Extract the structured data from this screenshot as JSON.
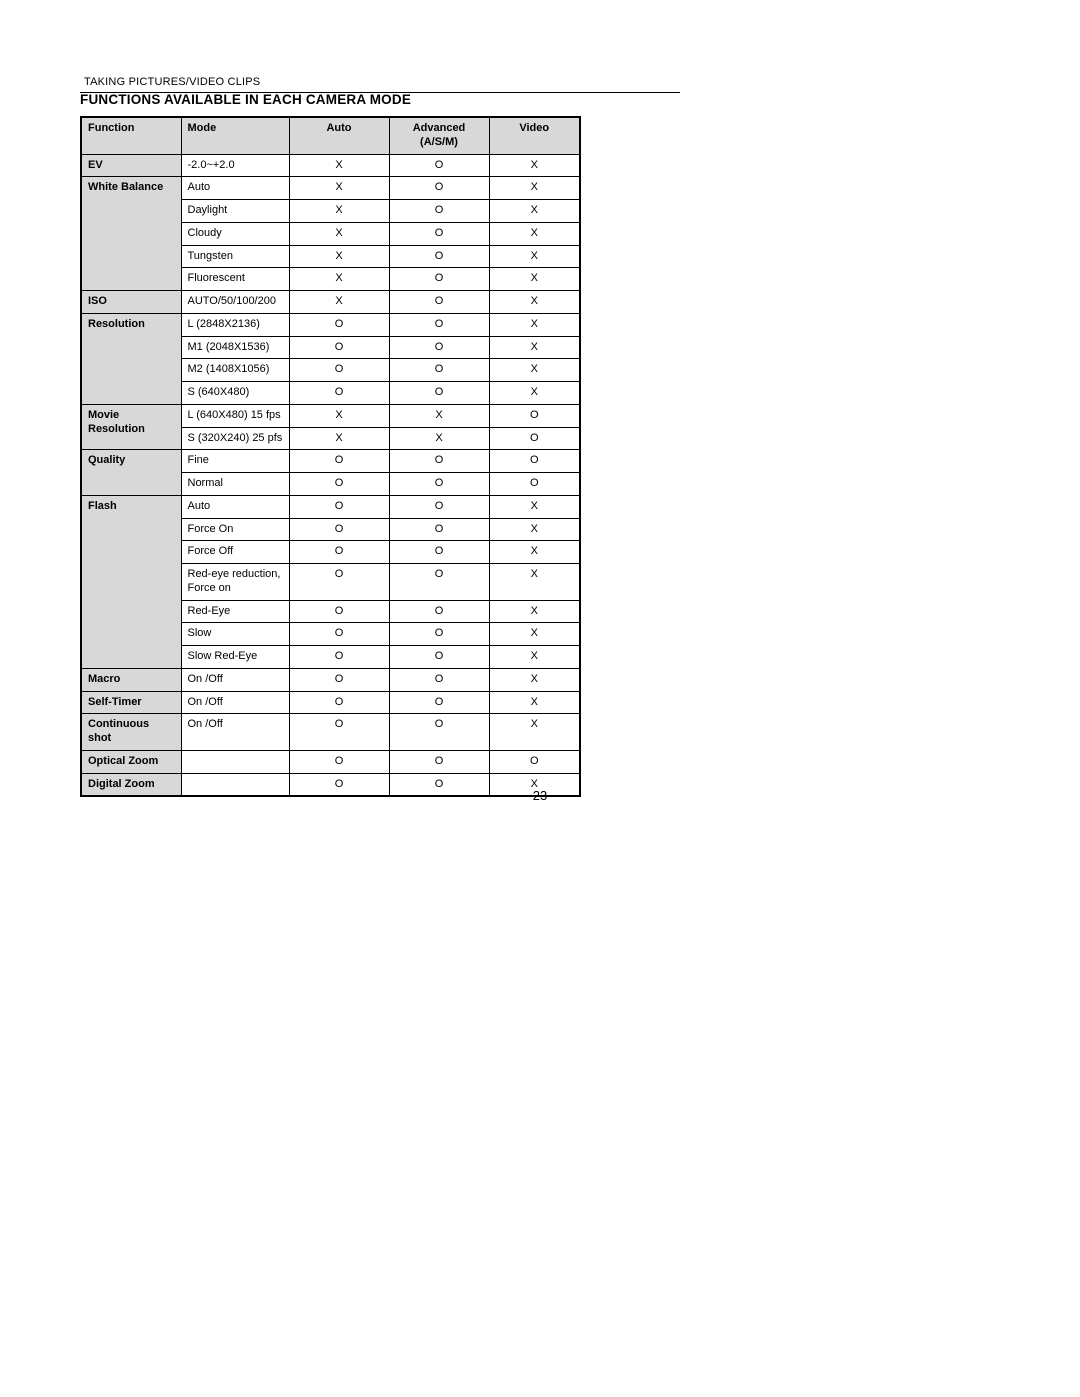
{
  "breadcrumb": "TAKING PICTURES/VIDEO CLIPS",
  "title": "FUNCTIONS AVAILABLE IN EACH CAMERA MODE",
  "page_number": "23",
  "headers": {
    "function": "Function",
    "mode": "Mode",
    "auto": "Auto",
    "advanced": "Advanced (A/S/M)",
    "video": "Video"
  },
  "rows": [
    {
      "function": "EV",
      "span": 1,
      "modes": [
        {
          "mode": "-2.0~+2.0",
          "auto": "X",
          "advanced": "O",
          "video": "X"
        }
      ]
    },
    {
      "function": "White Balance",
      "span": 5,
      "modes": [
        {
          "mode": "Auto",
          "auto": "X",
          "advanced": "O",
          "video": "X"
        },
        {
          "mode": "Daylight",
          "auto": "X",
          "advanced": "O",
          "video": "X"
        },
        {
          "mode": "Cloudy",
          "auto": "X",
          "advanced": "O",
          "video": "X"
        },
        {
          "mode": "Tungsten",
          "auto": "X",
          "advanced": "O",
          "video": "X"
        },
        {
          "mode": "Fluorescent",
          "auto": "X",
          "advanced": "O",
          "video": "X"
        }
      ]
    },
    {
      "function": "ISO",
      "span": 1,
      "modes": [
        {
          "mode": "AUTO/50/100/200",
          "auto": "X",
          "advanced": "O",
          "video": "X"
        }
      ]
    },
    {
      "function": "Resolution",
      "span": 4,
      "modes": [
        {
          "mode": "L (2848X2136)",
          "auto": "O",
          "advanced": "O",
          "video": "X"
        },
        {
          "mode": "M1 (2048X1536)",
          "auto": "O",
          "advanced": "O",
          "video": "X"
        },
        {
          "mode": "M2 (1408X1056)",
          "auto": "O",
          "advanced": "O",
          "video": "X"
        },
        {
          "mode": "S (640X480)",
          "auto": "O",
          "advanced": "O",
          "video": "X"
        }
      ]
    },
    {
      "function": "Movie Resolution",
      "span": 2,
      "modes": [
        {
          "mode": "L (640X480) 15 fps",
          "auto": "X",
          "advanced": "X",
          "video": "O"
        },
        {
          "mode": "S (320X240) 25 pfs",
          "auto": "X",
          "advanced": "X",
          "video": "O"
        }
      ]
    },
    {
      "function": "Quality",
      "span": 2,
      "modes": [
        {
          "mode": "Fine",
          "auto": "O",
          "advanced": "O",
          "video": "O"
        },
        {
          "mode": "Normal",
          "auto": "O",
          "advanced": "O",
          "video": "O"
        }
      ]
    },
    {
      "function": "Flash",
      "span": 7,
      "modes": [
        {
          "mode": "Auto",
          "auto": "O",
          "advanced": "O",
          "video": "X"
        },
        {
          "mode": "Force On",
          "auto": "O",
          "advanced": "O",
          "video": "X"
        },
        {
          "mode": "Force Off",
          "auto": "O",
          "advanced": "O",
          "video": "X"
        },
        {
          "mode": "Red-eye reduction, Force on",
          "auto": "O",
          "advanced": "O",
          "video": "X"
        },
        {
          "mode": "Red-Eye",
          "auto": "O",
          "advanced": "O",
          "video": "X"
        },
        {
          "mode": "Slow",
          "auto": "O",
          "advanced": "O",
          "video": "X"
        },
        {
          "mode": "Slow Red-Eye",
          "auto": "O",
          "advanced": "O",
          "video": "X"
        }
      ]
    },
    {
      "function": "Macro",
      "span": 1,
      "modes": [
        {
          "mode": "On /Off",
          "auto": "O",
          "advanced": "O",
          "video": "X"
        }
      ]
    },
    {
      "function": "Self-Timer",
      "span": 1,
      "modes": [
        {
          "mode": "On /Off",
          "auto": "O",
          "advanced": "O",
          "video": "X"
        }
      ]
    },
    {
      "function": "Continuous shot",
      "span": 1,
      "modes": [
        {
          "mode": "On /Off",
          "auto": "O",
          "advanced": "O",
          "video": "X"
        }
      ]
    },
    {
      "function": "Optical Zoom",
      "span": 1,
      "modes": [
        {
          "mode": "",
          "auto": "O",
          "advanced": "O",
          "video": "O"
        }
      ]
    },
    {
      "function": "Digital Zoom",
      "span": 1,
      "modes": [
        {
          "mode": "",
          "auto": "O",
          "advanced": "O",
          "video": "X"
        }
      ]
    }
  ]
}
